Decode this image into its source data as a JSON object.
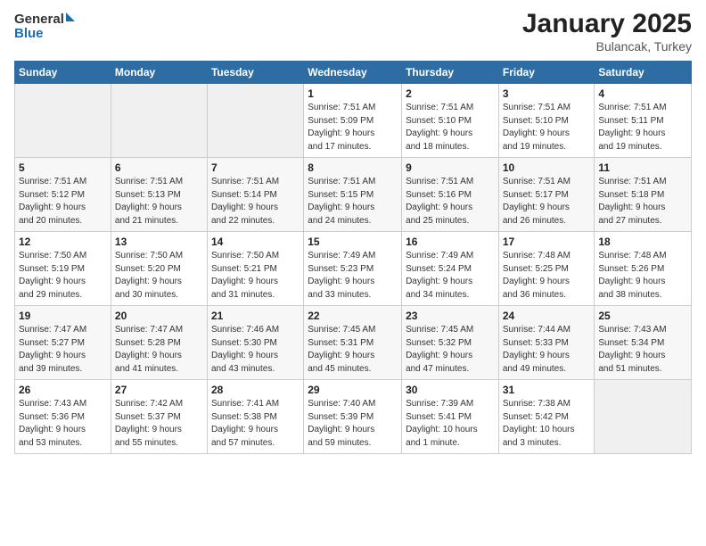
{
  "header": {
    "logo_general": "General",
    "logo_blue": "Blue",
    "title": "January 2025",
    "location": "Bulancak, Turkey"
  },
  "weekdays": [
    "Sunday",
    "Monday",
    "Tuesday",
    "Wednesday",
    "Thursday",
    "Friday",
    "Saturday"
  ],
  "weeks": [
    [
      {
        "day": "",
        "info": ""
      },
      {
        "day": "",
        "info": ""
      },
      {
        "day": "",
        "info": ""
      },
      {
        "day": "1",
        "info": "Sunrise: 7:51 AM\nSunset: 5:09 PM\nDaylight: 9 hours\nand 17 minutes."
      },
      {
        "day": "2",
        "info": "Sunrise: 7:51 AM\nSunset: 5:10 PM\nDaylight: 9 hours\nand 18 minutes."
      },
      {
        "day": "3",
        "info": "Sunrise: 7:51 AM\nSunset: 5:10 PM\nDaylight: 9 hours\nand 19 minutes."
      },
      {
        "day": "4",
        "info": "Sunrise: 7:51 AM\nSunset: 5:11 PM\nDaylight: 9 hours\nand 19 minutes."
      }
    ],
    [
      {
        "day": "5",
        "info": "Sunrise: 7:51 AM\nSunset: 5:12 PM\nDaylight: 9 hours\nand 20 minutes."
      },
      {
        "day": "6",
        "info": "Sunrise: 7:51 AM\nSunset: 5:13 PM\nDaylight: 9 hours\nand 21 minutes."
      },
      {
        "day": "7",
        "info": "Sunrise: 7:51 AM\nSunset: 5:14 PM\nDaylight: 9 hours\nand 22 minutes."
      },
      {
        "day": "8",
        "info": "Sunrise: 7:51 AM\nSunset: 5:15 PM\nDaylight: 9 hours\nand 24 minutes."
      },
      {
        "day": "9",
        "info": "Sunrise: 7:51 AM\nSunset: 5:16 PM\nDaylight: 9 hours\nand 25 minutes."
      },
      {
        "day": "10",
        "info": "Sunrise: 7:51 AM\nSunset: 5:17 PM\nDaylight: 9 hours\nand 26 minutes."
      },
      {
        "day": "11",
        "info": "Sunrise: 7:51 AM\nSunset: 5:18 PM\nDaylight: 9 hours\nand 27 minutes."
      }
    ],
    [
      {
        "day": "12",
        "info": "Sunrise: 7:50 AM\nSunset: 5:19 PM\nDaylight: 9 hours\nand 29 minutes."
      },
      {
        "day": "13",
        "info": "Sunrise: 7:50 AM\nSunset: 5:20 PM\nDaylight: 9 hours\nand 30 minutes."
      },
      {
        "day": "14",
        "info": "Sunrise: 7:50 AM\nSunset: 5:21 PM\nDaylight: 9 hours\nand 31 minutes."
      },
      {
        "day": "15",
        "info": "Sunrise: 7:49 AM\nSunset: 5:23 PM\nDaylight: 9 hours\nand 33 minutes."
      },
      {
        "day": "16",
        "info": "Sunrise: 7:49 AM\nSunset: 5:24 PM\nDaylight: 9 hours\nand 34 minutes."
      },
      {
        "day": "17",
        "info": "Sunrise: 7:48 AM\nSunset: 5:25 PM\nDaylight: 9 hours\nand 36 minutes."
      },
      {
        "day": "18",
        "info": "Sunrise: 7:48 AM\nSunset: 5:26 PM\nDaylight: 9 hours\nand 38 minutes."
      }
    ],
    [
      {
        "day": "19",
        "info": "Sunrise: 7:47 AM\nSunset: 5:27 PM\nDaylight: 9 hours\nand 39 minutes."
      },
      {
        "day": "20",
        "info": "Sunrise: 7:47 AM\nSunset: 5:28 PM\nDaylight: 9 hours\nand 41 minutes."
      },
      {
        "day": "21",
        "info": "Sunrise: 7:46 AM\nSunset: 5:30 PM\nDaylight: 9 hours\nand 43 minutes."
      },
      {
        "day": "22",
        "info": "Sunrise: 7:45 AM\nSunset: 5:31 PM\nDaylight: 9 hours\nand 45 minutes."
      },
      {
        "day": "23",
        "info": "Sunrise: 7:45 AM\nSunset: 5:32 PM\nDaylight: 9 hours\nand 47 minutes."
      },
      {
        "day": "24",
        "info": "Sunrise: 7:44 AM\nSunset: 5:33 PM\nDaylight: 9 hours\nand 49 minutes."
      },
      {
        "day": "25",
        "info": "Sunrise: 7:43 AM\nSunset: 5:34 PM\nDaylight: 9 hours\nand 51 minutes."
      }
    ],
    [
      {
        "day": "26",
        "info": "Sunrise: 7:43 AM\nSunset: 5:36 PM\nDaylight: 9 hours\nand 53 minutes."
      },
      {
        "day": "27",
        "info": "Sunrise: 7:42 AM\nSunset: 5:37 PM\nDaylight: 9 hours\nand 55 minutes."
      },
      {
        "day": "28",
        "info": "Sunrise: 7:41 AM\nSunset: 5:38 PM\nDaylight: 9 hours\nand 57 minutes."
      },
      {
        "day": "29",
        "info": "Sunrise: 7:40 AM\nSunset: 5:39 PM\nDaylight: 9 hours\nand 59 minutes."
      },
      {
        "day": "30",
        "info": "Sunrise: 7:39 AM\nSunset: 5:41 PM\nDaylight: 10 hours\nand 1 minute."
      },
      {
        "day": "31",
        "info": "Sunrise: 7:38 AM\nSunset: 5:42 PM\nDaylight: 10 hours\nand 3 minutes."
      },
      {
        "day": "",
        "info": ""
      }
    ]
  ]
}
